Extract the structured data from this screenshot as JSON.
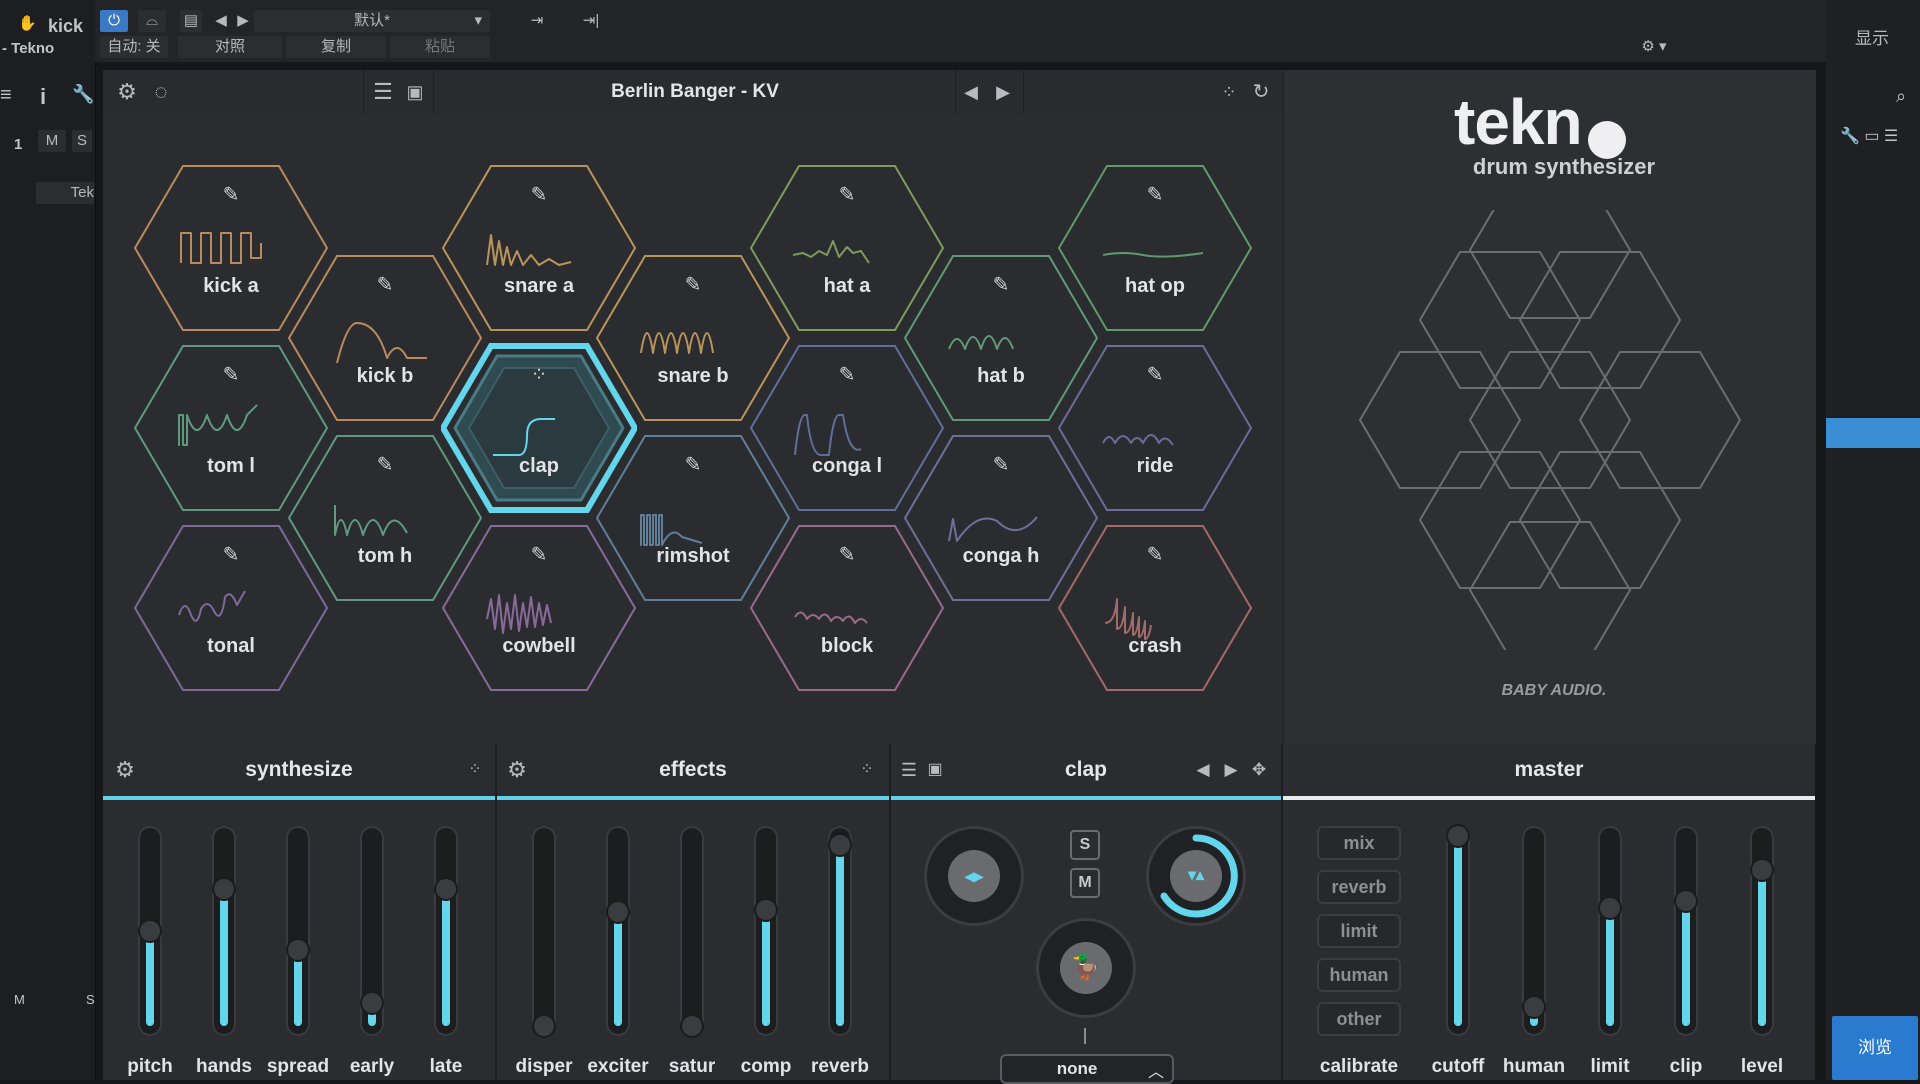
{
  "host": {
    "track_title": "kick",
    "track_subtitle": "- Tekno",
    "auto_label": "自动: 关",
    "compare_label": "对照",
    "copy_label": "复制",
    "paste_label": "粘贴",
    "preset_select": "默认*",
    "show_label": "显示",
    "browse_label": "浏览",
    "track_number": "1",
    "mute_label": "M",
    "solo_label": "S",
    "inst_label": "Tek",
    "bottom_m": "M",
    "bottom_s": "S",
    "info_label": "i"
  },
  "plugin": {
    "preset_name": "Berlin Banger - KV",
    "brand_title": "tekn",
    "brand_subtitle": "drum synthesizer",
    "maker": "BABY AUDIO."
  },
  "pads": [
    {
      "label": "kick a",
      "color": "#b88a5e"
    },
    {
      "label": "kick b",
      "color": "#b88a5e"
    },
    {
      "label": "snare a",
      "color": "#b9955a"
    },
    {
      "label": "snare b",
      "color": "#b9955a"
    },
    {
      "label": "hat a",
      "color": "#7e9a5f"
    },
    {
      "label": "hat b",
      "color": "#5f9a77"
    },
    {
      "label": "hat op",
      "color": "#5f9a6b"
    },
    {
      "label": "tom l",
      "color": "#5f9a7e"
    },
    {
      "label": "tom h",
      "color": "#5f9a7e"
    },
    {
      "label": "clap",
      "color": "#63d6ec"
    },
    {
      "label": "rimshot",
      "color": "#5f7f9a"
    },
    {
      "label": "conga l",
      "color": "#5f6f9a"
    },
    {
      "label": "conga h",
      "color": "#6f6f9a"
    },
    {
      "label": "ride",
      "color": "#6f6a9a"
    },
    {
      "label": "tonal",
      "color": "#7e6a9a"
    },
    {
      "label": "cowbell",
      "color": "#8a6a9a"
    },
    {
      "label": "block",
      "color": "#9a6a8a"
    },
    {
      "label": "crash",
      "color": "#a36a6a"
    }
  ],
  "sections": {
    "synthesize": "synthesize",
    "effects": "effects",
    "pad_name": "clap",
    "master": "master"
  },
  "synth_faders": [
    {
      "label": "pitch",
      "value": 0.5
    },
    {
      "label": "hands",
      "value": 0.72
    },
    {
      "label": "spread",
      "value": 0.4
    },
    {
      "label": "early",
      "value": 0.12
    },
    {
      "label": "late",
      "value": 0.72
    }
  ],
  "effect_faders": [
    {
      "label": "disper",
      "value": 0.0
    },
    {
      "label": "exciter",
      "value": 0.6
    },
    {
      "label": "satur",
      "value": 0.0
    },
    {
      "label": "comp",
      "value": 0.61
    },
    {
      "label": "reverb",
      "value": 0.95
    }
  ],
  "pad_controls": {
    "solo": "S",
    "mute": "M",
    "choke": "none"
  },
  "master_buttons": [
    "mix",
    "reverb",
    "limit",
    "human",
    "other"
  ],
  "master_faders": [
    {
      "label": "calibrate",
      "value": 0.0
    },
    {
      "label": "cutoff",
      "value": 1.0
    },
    {
      "label": "human",
      "value": 0.1
    },
    {
      "label": "limit",
      "value": 0.62
    },
    {
      "label": "clip",
      "value": 0.66
    },
    {
      "label": "level",
      "value": 0.82
    }
  ],
  "colors": {
    "accent": "#63d6ec",
    "panel": "#2b2c2f"
  }
}
